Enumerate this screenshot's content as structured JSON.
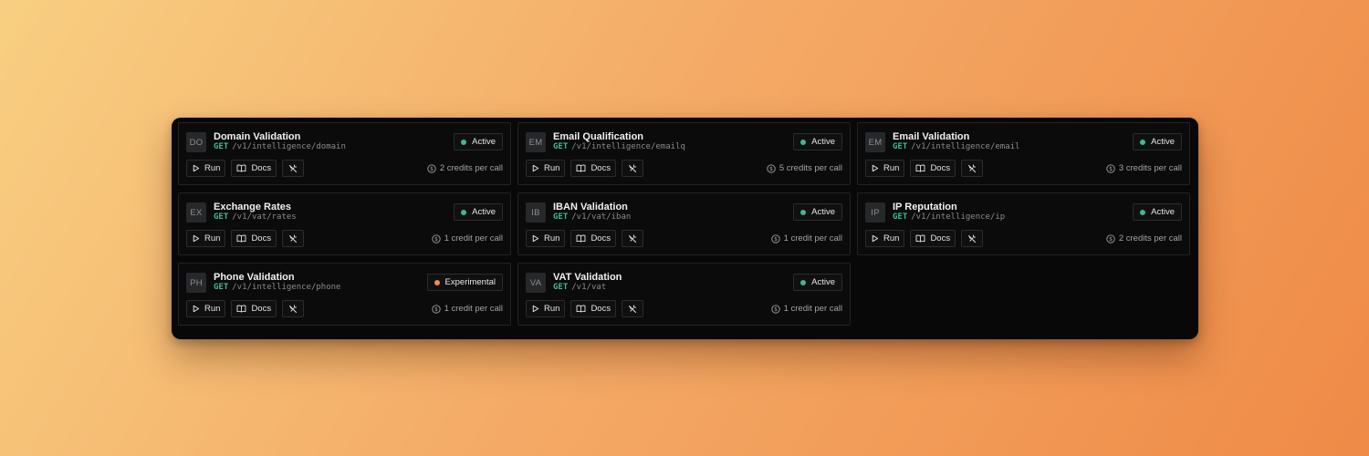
{
  "colors": {
    "active": "#3fb98e",
    "experimental": "#f28c4b",
    "method": "#3fb98e"
  },
  "endpoints": [
    {
      "abbr": "DO",
      "name": "Domain Validation",
      "method": "GET",
      "path": "/v1/intelligence/domain",
      "status": "Active",
      "status_color": "#3fb98e",
      "run": "Run",
      "docs": "Docs",
      "credits": "2 credits per call"
    },
    {
      "abbr": "EM",
      "name": "Email Qualification",
      "method": "GET",
      "path": "/v1/intelligence/emailq",
      "status": "Active",
      "status_color": "#3fb98e",
      "run": "Run",
      "docs": "Docs",
      "credits": "5 credits per call"
    },
    {
      "abbr": "EM",
      "name": "Email Validation",
      "method": "GET",
      "path": "/v1/intelligence/email",
      "status": "Active",
      "status_color": "#3fb98e",
      "run": "Run",
      "docs": "Docs",
      "credits": "3 credits per call"
    },
    {
      "abbr": "EX",
      "name": "Exchange Rates",
      "method": "GET",
      "path": "/v1/vat/rates",
      "status": "Active",
      "status_color": "#3fb98e",
      "run": "Run",
      "docs": "Docs",
      "credits": "1 credit per call"
    },
    {
      "abbr": "IB",
      "name": "IBAN Validation",
      "method": "GET",
      "path": "/v1/vat/iban",
      "status": "Active",
      "status_color": "#3fb98e",
      "run": "Run",
      "docs": "Docs",
      "credits": "1 credit per call"
    },
    {
      "abbr": "IP",
      "name": "IP Reputation",
      "method": "GET",
      "path": "/v1/intelligence/ip",
      "status": "Active",
      "status_color": "#3fb98e",
      "run": "Run",
      "docs": "Docs",
      "credits": "2 credits per call"
    },
    {
      "abbr": "PH",
      "name": "Phone Validation",
      "method": "GET",
      "path": "/v1/intelligence/phone",
      "status": "Experimental",
      "status_color": "#f28c4b",
      "run": "Run",
      "docs": "Docs",
      "credits": "1 credit per call"
    },
    {
      "abbr": "VA",
      "name": "VAT Validation",
      "method": "GET",
      "path": "/v1/vat",
      "status": "Active",
      "status_color": "#3fb98e",
      "run": "Run",
      "docs": "Docs",
      "credits": "1 credit per call"
    }
  ],
  "icons": {
    "run": "play-icon",
    "docs": "book-open-icon",
    "disable": "wand-off-icon",
    "credits": "coin-icon"
  }
}
